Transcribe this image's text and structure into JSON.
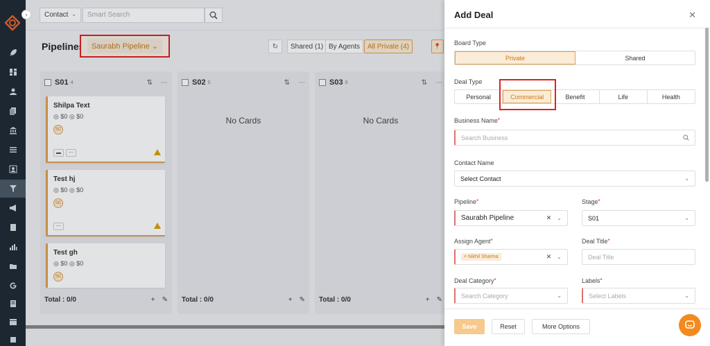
{
  "topbar": {
    "contact_select": "Contact",
    "search_placeholder": "Smart Search"
  },
  "pipeline_bar": {
    "title": "Pipelines",
    "pipeline_selected": "Saurabh Pipeline",
    "shared_label": "Shared (1)",
    "agents_label": "By Agents",
    "private_label": "All Private (4)"
  },
  "columns": [
    {
      "name": "S01",
      "count": "4",
      "total": "Total : 0/0",
      "cards": [
        {
          "title": "Shilpa Text",
          "amount": "◎ $0 ◎ $0",
          "avatar": "SC",
          "chips": [
            "▬",
            "⋯"
          ]
        },
        {
          "title": "Test hj",
          "amount": "◎ $0 ◎ $0",
          "avatar": "SC",
          "chips": [
            "⋯"
          ]
        },
        {
          "title": "Test gh",
          "amount": "◎ $0 ◎ $0",
          "avatar": "SC",
          "chips": []
        }
      ]
    },
    {
      "name": "S02",
      "count": "0",
      "total": "Total : 0/0",
      "empty": "No Cards"
    },
    {
      "name": "S03",
      "count": "0",
      "total": "Total : 0/0",
      "empty": "No Cards"
    }
  ],
  "panel": {
    "title": "Add Deal",
    "board_type_label": "Board Type",
    "board_options": [
      "Private",
      "Shared"
    ],
    "deal_type_label": "Deal Type",
    "deal_options": [
      "Personal",
      "Commercial",
      "Benefit",
      "Life",
      "Health"
    ],
    "business_name_label": "Business Name",
    "business_placeholder": "Search Business",
    "contact_name_label": "Contact Name",
    "contact_value": "Select Contact",
    "pipeline_label": "Pipeline",
    "pipeline_value": "Saurabh Pipeline",
    "stage_label": "Stage",
    "stage_value": "S01",
    "assign_agent_label": "Assign Agent",
    "agent_tag": "Nikhil Sharma",
    "deal_title_label": "Deal Title",
    "deal_title_placeholder": "Deal Title",
    "deal_category_label": "Deal Category",
    "category_placeholder": "Search Category",
    "labels_label": "Labels",
    "labels_placeholder": "Select Labels",
    "save": "Save",
    "reset": "Reset",
    "more": "More Options"
  },
  "colors": {
    "accent": "#e0a050",
    "accent_text": "#c87a1e",
    "sidebar": "#1f2a35",
    "highlight": "#e02020",
    "fab": "#f28a1e"
  }
}
